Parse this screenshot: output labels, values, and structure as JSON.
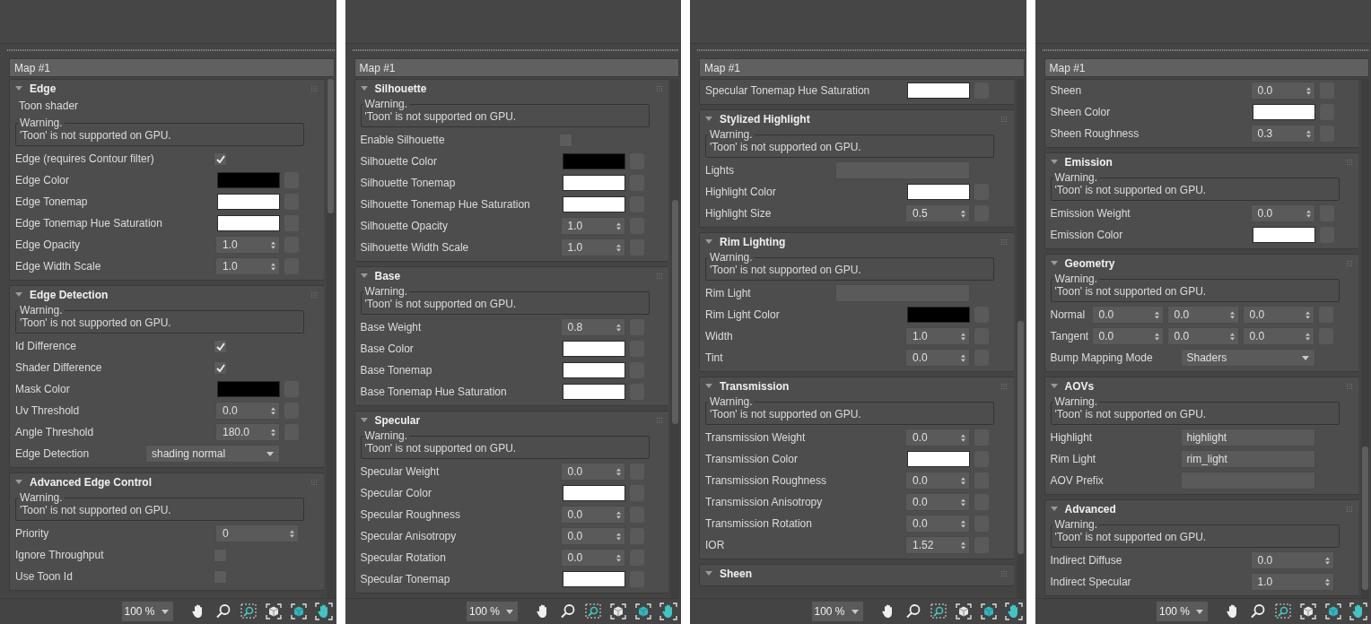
{
  "panels": [
    {
      "map_title": "Map #1",
      "zoom": "100 %",
      "rollouts": [
        {
          "title": "Edge",
          "expanded": true,
          "rows": [
            {
              "kind": "note",
              "text": "Toon shader"
            },
            {
              "kind": "warning",
              "title": "Warning.",
              "text": "'Toon' is not supported on GPU."
            },
            {
              "kind": "checkbox",
              "label": "Edge (requires Contour filter)",
              "checked": true
            },
            {
              "kind": "color",
              "label": "Edge Color",
              "color": "#000000",
              "map_slot": true
            },
            {
              "kind": "color",
              "label": "Edge Tonemap",
              "color": "#ffffff",
              "map_slot": true
            },
            {
              "kind": "color",
              "label": "Edge Tonemap Hue Saturation",
              "color": "#ffffff",
              "map_slot": true
            },
            {
              "kind": "spinner",
              "label": "Edge Opacity",
              "value": "1.0",
              "map_slot": true
            },
            {
              "kind": "spinner",
              "label": "Edge Width Scale",
              "value": "1.0",
              "map_slot": true
            }
          ]
        },
        {
          "title": "Edge Detection",
          "expanded": true,
          "rows": [
            {
              "kind": "warning",
              "title": "Warning.",
              "text": "'Toon' is not supported on GPU."
            },
            {
              "kind": "checkbox",
              "label": "Id Difference",
              "checked": true
            },
            {
              "kind": "checkbox",
              "label": "Shader Difference",
              "checked": true
            },
            {
              "kind": "color",
              "label": "Mask Color",
              "color": "#000000",
              "map_slot": true
            },
            {
              "kind": "spinner",
              "label": "Uv Threshold",
              "value": "0.0",
              "map_slot": true
            },
            {
              "kind": "spinner",
              "label": "Angle Threshold",
              "value": "180.0",
              "map_slot": true
            },
            {
              "kind": "dropdown",
              "label": "Edge Detection",
              "value": "shading normal"
            }
          ]
        },
        {
          "title": "Advanced Edge Control",
          "expanded": true,
          "rows": [
            {
              "kind": "warning",
              "title": "Warning.",
              "text": "'Toon' is not supported on GPU."
            },
            {
              "kind": "spinner",
              "label": "Priority",
              "value": "0",
              "map_slot": false
            },
            {
              "kind": "checkbox",
              "label": "Ignore Throughput",
              "checked": false
            },
            {
              "kind": "checkbox",
              "label": "Use Toon Id",
              "checked": false
            }
          ]
        }
      ]
    },
    {
      "map_title": "Map #1",
      "zoom": "100 %",
      "rollouts": [
        {
          "title": "Silhouette",
          "expanded": true,
          "rows": [
            {
              "kind": "warning",
              "title": "Warning.",
              "text": "'Toon' is not supported on GPU."
            },
            {
              "kind": "checkbox",
              "label": "Enable Silhouette",
              "checked": false
            },
            {
              "kind": "color",
              "label": "Silhouette Color",
              "color": "#000000",
              "map_slot": true
            },
            {
              "kind": "color",
              "label": "Silhouette Tonemap",
              "color": "#ffffff",
              "map_slot": true
            },
            {
              "kind": "color",
              "label": "Silhouette Tonemap Hue Saturation",
              "color": "#ffffff",
              "map_slot": true
            },
            {
              "kind": "spinner",
              "label": "Silhouette Opacity",
              "value": "1.0",
              "map_slot": true
            },
            {
              "kind": "spinner",
              "label": "Silhouette Width Scale",
              "value": "1.0",
              "map_slot": true
            }
          ]
        },
        {
          "title": "Base",
          "expanded": true,
          "rows": [
            {
              "kind": "warning",
              "title": "Warning.",
              "text": "'Toon' is not supported on GPU."
            },
            {
              "kind": "spinner",
              "label": "Base Weight",
              "value": "0.8",
              "map_slot": true
            },
            {
              "kind": "color",
              "label": "Base Color",
              "color": "#ffffff",
              "map_slot": true
            },
            {
              "kind": "color",
              "label": "Base Tonemap",
              "color": "#ffffff",
              "map_slot": true
            },
            {
              "kind": "color",
              "label": "Base Tonemap Hue Saturation",
              "color": "#ffffff",
              "map_slot": true
            }
          ]
        },
        {
          "title": "Specular",
          "expanded": true,
          "rows": [
            {
              "kind": "warning",
              "title": "Warning.",
              "text": "'Toon' is not supported on GPU."
            },
            {
              "kind": "spinner",
              "label": "Specular Weight",
              "value": "0.0",
              "map_slot": true
            },
            {
              "kind": "color",
              "label": "Specular Color",
              "color": "#ffffff",
              "map_slot": true
            },
            {
              "kind": "spinner",
              "label": "Specular Roughness",
              "value": "0.0",
              "map_slot": true
            },
            {
              "kind": "spinner",
              "label": "Specular Anisotropy",
              "value": "0.0",
              "map_slot": true
            },
            {
              "kind": "spinner",
              "label": "Specular Rotation",
              "value": "0.0",
              "map_slot": true
            },
            {
              "kind": "color",
              "label": "Specular Tonemap",
              "color": "#ffffff",
              "map_slot": true
            }
          ]
        }
      ]
    },
    {
      "map_title": "Map #1",
      "zoom": "100 %",
      "rollouts": [
        {
          "rows": [
            {
              "kind": "color",
              "label": "Specular Tonemap Hue Saturation",
              "color": "#ffffff",
              "map_slot": true
            }
          ]
        },
        {
          "title": "Stylized Highlight",
          "expanded": true,
          "rows": [
            {
              "kind": "warning",
              "title": "Warning.",
              "text": "'Toon' is not supported on GPU."
            },
            {
              "kind": "text",
              "label": "Lights"
            },
            {
              "kind": "color",
              "label": "Highlight Color",
              "color": "#ffffff",
              "map_slot": true
            },
            {
              "kind": "spinner",
              "label": "Highlight Size",
              "value": "0.5",
              "map_slot": true
            }
          ]
        },
        {
          "title": "Rim Lighting",
          "expanded": true,
          "rows": [
            {
              "kind": "warning",
              "title": "Warning.",
              "text": "'Toon' is not supported on GPU."
            },
            {
              "kind": "text",
              "label": "Rim Light"
            },
            {
              "kind": "color",
              "label": "Rim Light Color",
              "color": "#000000",
              "map_slot": true
            },
            {
              "kind": "spinner",
              "label": "Width",
              "value": "1.0",
              "map_slot": true
            },
            {
              "kind": "spinner",
              "label": "Tint",
              "value": "0.0",
              "map_slot": true
            }
          ]
        },
        {
          "title": "Transmission",
          "expanded": true,
          "rows": [
            {
              "kind": "warning",
              "title": "Warning.",
              "text": "'Toon' is not supported on GPU."
            },
            {
              "kind": "spinner",
              "label": "Transmission Weight",
              "value": "0.0",
              "map_slot": true
            },
            {
              "kind": "color",
              "label": "Transmission Color",
              "color": "#ffffff",
              "map_slot": true
            },
            {
              "kind": "spinner",
              "label": "Transmission Roughness",
              "value": "0.0",
              "map_slot": true
            },
            {
              "kind": "spinner",
              "label": "Transmission Anisotropy",
              "value": "0.0",
              "map_slot": true
            },
            {
              "kind": "spinner",
              "label": "Transmission Rotation",
              "value": "0.0",
              "map_slot": true
            },
            {
              "kind": "spinner",
              "label": "IOR",
              "value": "1.52",
              "map_slot": true
            }
          ]
        },
        {
          "title": "Sheen",
          "expanded": true
        }
      ]
    },
    {
      "map_title": "Map #1",
      "zoom": "100 %",
      "rollouts": [
        {
          "rows": [
            {
              "kind": "spinner",
              "label": "Sheen",
              "value": "0.0",
              "map_slot": true
            },
            {
              "kind": "color",
              "label": "Sheen Color",
              "color": "#ffffff",
              "map_slot": true
            },
            {
              "kind": "spinner",
              "label": "Sheen Roughness",
              "value": "0.3",
              "map_slot": true
            }
          ]
        },
        {
          "title": "Emission",
          "expanded": true,
          "rows": [
            {
              "kind": "warning",
              "title": "Warning.",
              "text": "'Toon' is not supported on GPU."
            },
            {
              "kind": "spinner",
              "label": "Emission Weight",
              "value": "0.0",
              "map_slot": true
            },
            {
              "kind": "color",
              "label": "Emission Color",
              "color": "#ffffff",
              "map_slot": true
            }
          ]
        },
        {
          "title": "Geometry",
          "expanded": true,
          "rows": [
            {
              "kind": "warning",
              "title": "Warning.",
              "text": "'Toon' is not supported on GPU."
            },
            {
              "kind": "vector",
              "label": "Normal",
              "values": [
                "0.0",
                "0.0",
                "0.0"
              ],
              "map_slot": true
            },
            {
              "kind": "vector",
              "label": "Tangent",
              "values": [
                "0.0",
                "0.0",
                "0.0"
              ],
              "map_slot": true
            },
            {
              "kind": "dropdown",
              "label": "Bump Mapping Mode",
              "value": "Shaders"
            }
          ]
        },
        {
          "title": "AOVs",
          "expanded": true,
          "rows": [
            {
              "kind": "warning",
              "title": "Warning.",
              "text": "'Toon' is not supported on GPU."
            },
            {
              "kind": "text",
              "label": "Highlight",
              "value": "highlight"
            },
            {
              "kind": "text",
              "label": "Rim Light",
              "value": "rim_light"
            },
            {
              "kind": "text",
              "label": "AOV Prefix"
            }
          ]
        },
        {
          "title": "Advanced",
          "expanded": true,
          "rows": [
            {
              "kind": "warning",
              "title": "Warning.",
              "text": "'Toon' is not supported on GPU."
            },
            {
              "kind": "spinner",
              "label": "Indirect Diffuse",
              "value": "0.0",
              "map_slot": false
            },
            {
              "kind": "spinner",
              "label": "Indirect Specular",
              "value": "1.0",
              "map_slot": false
            }
          ]
        }
      ]
    }
  ]
}
